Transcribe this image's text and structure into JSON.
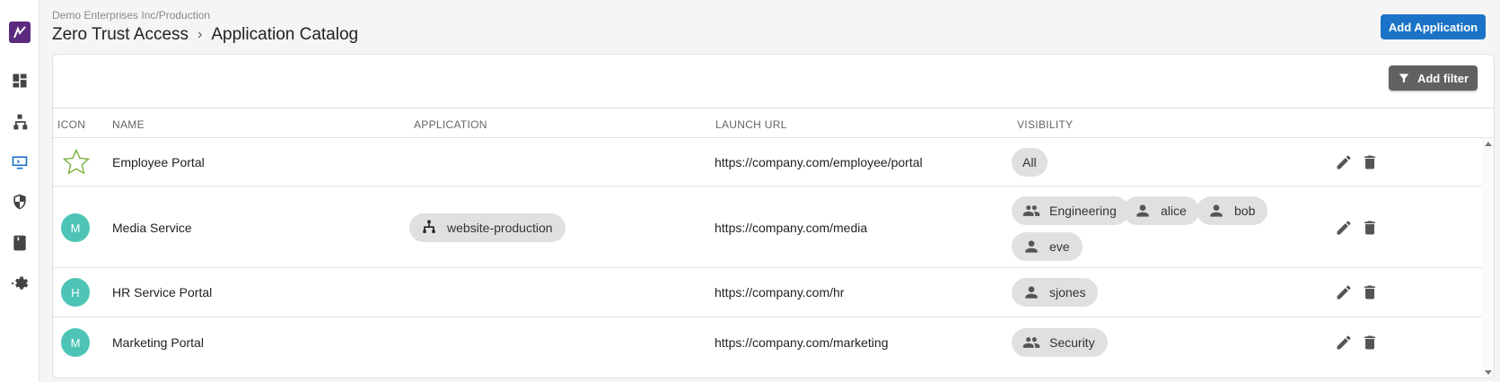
{
  "header": {
    "org": "Demo Enterprises Inc/Production",
    "breadcrumb": [
      "Zero Trust Access",
      "Application Catalog"
    ],
    "separator": "›",
    "add_application_label": "Add Application"
  },
  "sidebar": {
    "items": [
      {
        "icon": "dashboard-icon"
      },
      {
        "icon": "network-hierarchy-icon"
      },
      {
        "icon": "application-catalog-icon",
        "active": true
      },
      {
        "icon": "shield-icon"
      },
      {
        "icon": "book-icon"
      },
      {
        "icon": "settings-gear-icon"
      }
    ]
  },
  "toolbar": {
    "add_filter_label": "Add filter"
  },
  "table": {
    "columns": [
      "ICON",
      "NAME",
      "APPLICATION",
      "LAUNCH URL",
      "VISIBILITY"
    ],
    "rows": [
      {
        "icon": "star-icon",
        "name": "Employee Portal",
        "application": "",
        "launch_url": "https://company.com/employee/portal",
        "visibility": [
          {
            "label": "All",
            "type": "all"
          }
        ]
      },
      {
        "icon_letter": "M",
        "name": "Media Service",
        "application": "website-production",
        "launch_url": "https://company.com/media",
        "visibility": [
          {
            "label": "Engineering",
            "type": "group"
          },
          {
            "label": "alice",
            "type": "user"
          },
          {
            "label": "bob",
            "type": "user"
          },
          {
            "label": "eve",
            "type": "user"
          }
        ]
      },
      {
        "icon_letter": "H",
        "name": "HR Service Portal",
        "application": "",
        "launch_url": "https://company.com/hr",
        "visibility": [
          {
            "label": "sjones",
            "type": "user"
          }
        ]
      },
      {
        "icon_letter": "M",
        "name": "Marketing Portal",
        "application": "",
        "launch_url": "https://company.com/marketing",
        "visibility": [
          {
            "label": "Security",
            "type": "group"
          }
        ]
      }
    ]
  },
  "colors": {
    "primary": "#1a73c6",
    "avatar": "#4dc4b5",
    "brand": "#5b2a7e",
    "filter_button": "#616161",
    "star": "#7cb342"
  }
}
